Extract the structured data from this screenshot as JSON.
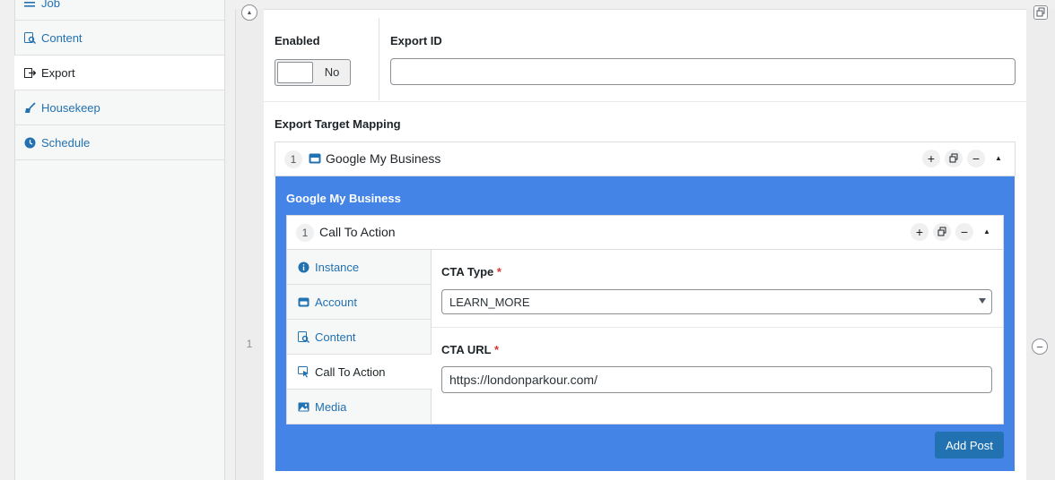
{
  "sidebar": {
    "items": [
      {
        "label": "Job",
        "icon": "list-icon"
      },
      {
        "label": "Content",
        "icon": "search-doc-icon"
      },
      {
        "label": "Export",
        "icon": "export-icon",
        "active": true
      },
      {
        "label": "Housekeep",
        "icon": "broom-icon"
      },
      {
        "label": "Schedule",
        "icon": "clock-icon"
      }
    ]
  },
  "outer_repeater": {
    "index": "1"
  },
  "form": {
    "enabled_label": "Enabled",
    "toggle_text": "No",
    "export_id_label": "Export ID",
    "export_id_value": "",
    "mapping_label": "Export Target Mapping"
  },
  "target": {
    "index": "1",
    "title": "Google My Business",
    "panel_title": "Google My Business",
    "controls": {
      "add": "+",
      "duplicate": "⧉",
      "remove": "−",
      "collapse": "▲"
    }
  },
  "cta_group": {
    "index": "1",
    "title": "Call To Action",
    "tabs": [
      {
        "label": "Instance",
        "icon": "info-icon"
      },
      {
        "label": "Account",
        "icon": "account-card-icon"
      },
      {
        "label": "Content",
        "icon": "search-doc-icon"
      },
      {
        "label": "Call To Action",
        "icon": "cursor-click-icon",
        "active": true
      },
      {
        "label": "Media",
        "icon": "image-icon"
      }
    ],
    "cta_type_label": "CTA Type",
    "cta_type_value": "LEARN_MORE",
    "cta_url_label": "CTA URL",
    "cta_url_value": "https://londonparkour.com/",
    "required_mark": "*"
  },
  "add_post_button": "Add Post",
  "colors": {
    "accent": "#4384e6",
    "link": "#2271b1",
    "button": "#2271b1",
    "required": "#d63638"
  }
}
